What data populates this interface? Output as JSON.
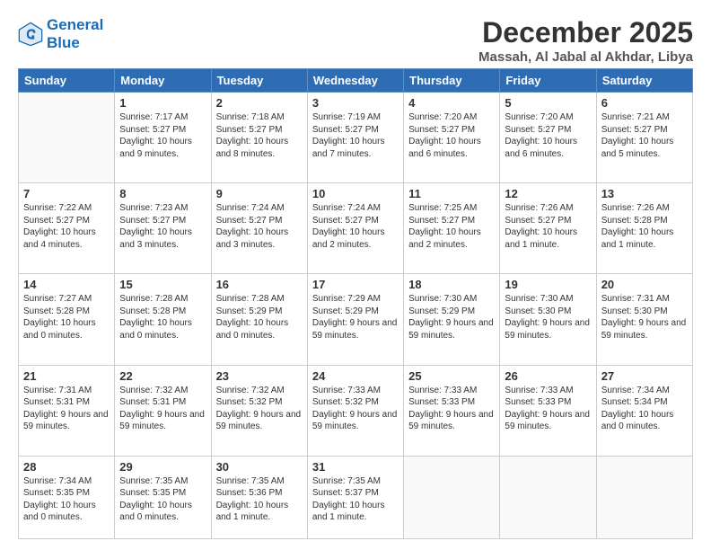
{
  "logo": {
    "line1": "General",
    "line2": "Blue"
  },
  "title": "December 2025",
  "subtitle": "Massah, Al Jabal al Akhdar, Libya",
  "days_header": [
    "Sunday",
    "Monday",
    "Tuesday",
    "Wednesday",
    "Thursday",
    "Friday",
    "Saturday"
  ],
  "weeks": [
    [
      {
        "day": "",
        "empty": true
      },
      {
        "day": "1",
        "sunrise": "7:17 AM",
        "sunset": "5:27 PM",
        "daylight": "10 hours and 9 minutes."
      },
      {
        "day": "2",
        "sunrise": "7:18 AM",
        "sunset": "5:27 PM",
        "daylight": "10 hours and 8 minutes."
      },
      {
        "day": "3",
        "sunrise": "7:19 AM",
        "sunset": "5:27 PM",
        "daylight": "10 hours and 7 minutes."
      },
      {
        "day": "4",
        "sunrise": "7:20 AM",
        "sunset": "5:27 PM",
        "daylight": "10 hours and 6 minutes."
      },
      {
        "day": "5",
        "sunrise": "7:20 AM",
        "sunset": "5:27 PM",
        "daylight": "10 hours and 6 minutes."
      },
      {
        "day": "6",
        "sunrise": "7:21 AM",
        "sunset": "5:27 PM",
        "daylight": "10 hours and 5 minutes."
      }
    ],
    [
      {
        "day": "7",
        "sunrise": "7:22 AM",
        "sunset": "5:27 PM",
        "daylight": "10 hours and 4 minutes."
      },
      {
        "day": "8",
        "sunrise": "7:23 AM",
        "sunset": "5:27 PM",
        "daylight": "10 hours and 3 minutes."
      },
      {
        "day": "9",
        "sunrise": "7:24 AM",
        "sunset": "5:27 PM",
        "daylight": "10 hours and 3 minutes."
      },
      {
        "day": "10",
        "sunrise": "7:24 AM",
        "sunset": "5:27 PM",
        "daylight": "10 hours and 2 minutes."
      },
      {
        "day": "11",
        "sunrise": "7:25 AM",
        "sunset": "5:27 PM",
        "daylight": "10 hours and 2 minutes."
      },
      {
        "day": "12",
        "sunrise": "7:26 AM",
        "sunset": "5:27 PM",
        "daylight": "10 hours and 1 minute."
      },
      {
        "day": "13",
        "sunrise": "7:26 AM",
        "sunset": "5:28 PM",
        "daylight": "10 hours and 1 minute."
      }
    ],
    [
      {
        "day": "14",
        "sunrise": "7:27 AM",
        "sunset": "5:28 PM",
        "daylight": "10 hours and 0 minutes."
      },
      {
        "day": "15",
        "sunrise": "7:28 AM",
        "sunset": "5:28 PM",
        "daylight": "10 hours and 0 minutes."
      },
      {
        "day": "16",
        "sunrise": "7:28 AM",
        "sunset": "5:29 PM",
        "daylight": "10 hours and 0 minutes."
      },
      {
        "day": "17",
        "sunrise": "7:29 AM",
        "sunset": "5:29 PM",
        "daylight": "9 hours and 59 minutes."
      },
      {
        "day": "18",
        "sunrise": "7:30 AM",
        "sunset": "5:29 PM",
        "daylight": "9 hours and 59 minutes."
      },
      {
        "day": "19",
        "sunrise": "7:30 AM",
        "sunset": "5:30 PM",
        "daylight": "9 hours and 59 minutes."
      },
      {
        "day": "20",
        "sunrise": "7:31 AM",
        "sunset": "5:30 PM",
        "daylight": "9 hours and 59 minutes."
      }
    ],
    [
      {
        "day": "21",
        "sunrise": "7:31 AM",
        "sunset": "5:31 PM",
        "daylight": "9 hours and 59 minutes."
      },
      {
        "day": "22",
        "sunrise": "7:32 AM",
        "sunset": "5:31 PM",
        "daylight": "9 hours and 59 minutes."
      },
      {
        "day": "23",
        "sunrise": "7:32 AM",
        "sunset": "5:32 PM",
        "daylight": "9 hours and 59 minutes."
      },
      {
        "day": "24",
        "sunrise": "7:33 AM",
        "sunset": "5:32 PM",
        "daylight": "9 hours and 59 minutes."
      },
      {
        "day": "25",
        "sunrise": "7:33 AM",
        "sunset": "5:33 PM",
        "daylight": "9 hours and 59 minutes."
      },
      {
        "day": "26",
        "sunrise": "7:33 AM",
        "sunset": "5:33 PM",
        "daylight": "9 hours and 59 minutes."
      },
      {
        "day": "27",
        "sunrise": "7:34 AM",
        "sunset": "5:34 PM",
        "daylight": "10 hours and 0 minutes."
      }
    ],
    [
      {
        "day": "28",
        "sunrise": "7:34 AM",
        "sunset": "5:35 PM",
        "daylight": "10 hours and 0 minutes."
      },
      {
        "day": "29",
        "sunrise": "7:35 AM",
        "sunset": "5:35 PM",
        "daylight": "10 hours and 0 minutes."
      },
      {
        "day": "30",
        "sunrise": "7:35 AM",
        "sunset": "5:36 PM",
        "daylight": "10 hours and 1 minute."
      },
      {
        "day": "31",
        "sunrise": "7:35 AM",
        "sunset": "5:37 PM",
        "daylight": "10 hours and 1 minute."
      },
      {
        "day": "",
        "empty": true
      },
      {
        "day": "",
        "empty": true
      },
      {
        "day": "",
        "empty": true
      }
    ]
  ]
}
